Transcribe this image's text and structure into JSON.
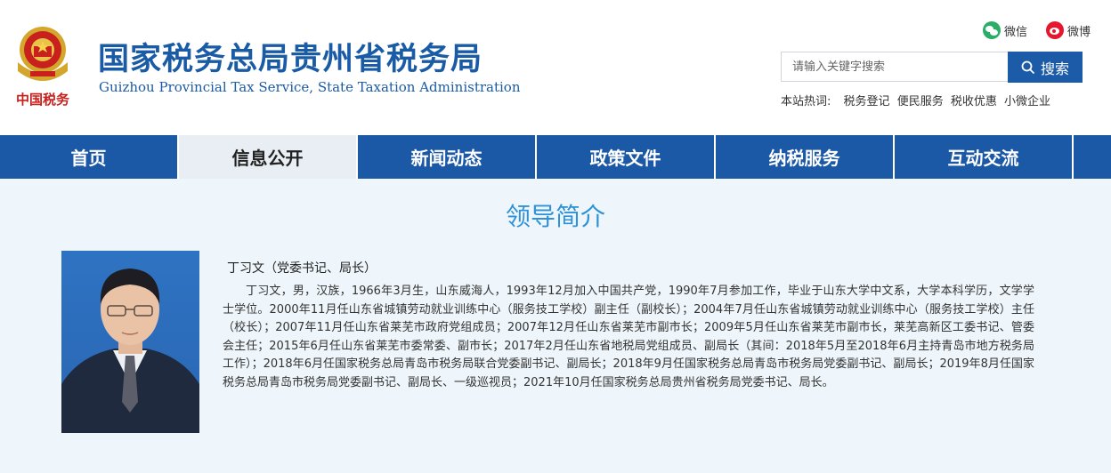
{
  "header": {
    "title": "国家税务总局贵州省税务局",
    "subtitle": "Guizhou Provincial Tax Service, State Taxation Administration",
    "logo_text": "中国税务"
  },
  "social": {
    "wechat_label": "微信",
    "weibo_label": "微博"
  },
  "search": {
    "placeholder": "请输入关键字搜索",
    "button_label": "搜索"
  },
  "hot": {
    "label": "本站热词:",
    "items": [
      "税务登记",
      "便民服务",
      "税收优惠",
      "小微企业"
    ]
  },
  "nav": {
    "items": [
      {
        "label": "首页",
        "active": false
      },
      {
        "label": "信息公开",
        "active": true
      },
      {
        "label": "新闻动态",
        "active": false
      },
      {
        "label": "政策文件",
        "active": false
      },
      {
        "label": "纳税服务",
        "active": false
      },
      {
        "label": "互动交流",
        "active": false
      }
    ]
  },
  "main": {
    "title": "领导简介",
    "leader_name": "丁习文（党委书记、局长）",
    "bio": "丁习文，男，汉族，1966年3月生，山东威海人，1993年12月加入中国共产党，1990年7月参加工作，毕业于山东大学中文系，大学本科学历，文学学士学位。2000年11月任山东省城镇劳动就业训练中心（服务技工学校）副主任（副校长）；2004年7月任山东省城镇劳动就业训练中心（服务技工学校）主任（校长）；2007年11月任山东省莱芜市政府党组成员；2007年12月任山东省莱芜市副市长；2009年5月任山东省莱芜市副市长，莱芜高新区工委书记、管委会主任；2015年6月任山东省莱芜市委常委、副市长；2017年2月任山东省地税局党组成员、副局长（其间：2018年5月至2018年6月主持青岛市地方税务局工作）；2018年6月任国家税务总局青岛市税务局联合党委副书记、副局长；2018年9月任国家税务总局青岛市税务局党委副书记、副局长；2019年8月任国家税务总局青岛市税务局党委副书记、副局长、一级巡视员；2021年10月任国家税务总局贵州省税务局党委书记、局长。"
  },
  "colors": {
    "brand_blue": "#1b58a6",
    "title_blue": "#2f92d6",
    "background": "#eef6fb"
  }
}
